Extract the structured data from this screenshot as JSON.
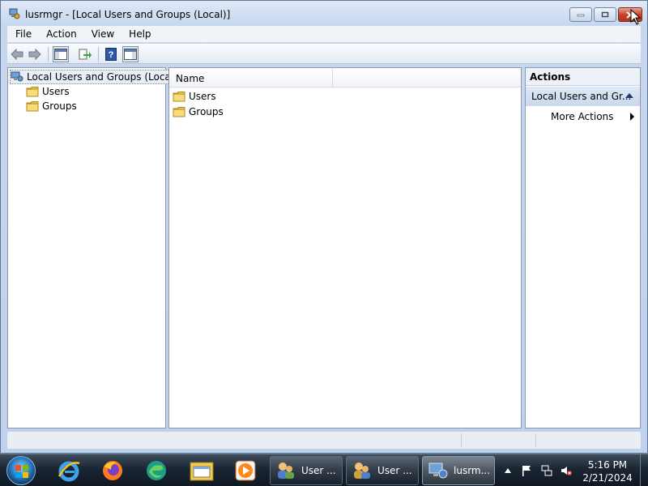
{
  "window": {
    "title": "lusrmgr - [Local Users and Groups (Local)]"
  },
  "menu": [
    "File",
    "Action",
    "View",
    "Help"
  ],
  "tree": {
    "root": "Local Users and Groups (Local)",
    "children": [
      "Users",
      "Groups"
    ]
  },
  "list": {
    "column_header": "Name",
    "items": [
      "Users",
      "Groups"
    ]
  },
  "actions": {
    "title": "Actions",
    "section": "Local Users and Gr...",
    "more": "More Actions"
  },
  "taskbar": {
    "buttons": [
      "User ...",
      "User ...",
      "lusrm..."
    ],
    "time": "5:16 PM",
    "date": "2/21/2024"
  },
  "colors": {
    "accent": "#2d7cc6",
    "folder": "#f0c94a",
    "close_button": "#c7432a"
  }
}
